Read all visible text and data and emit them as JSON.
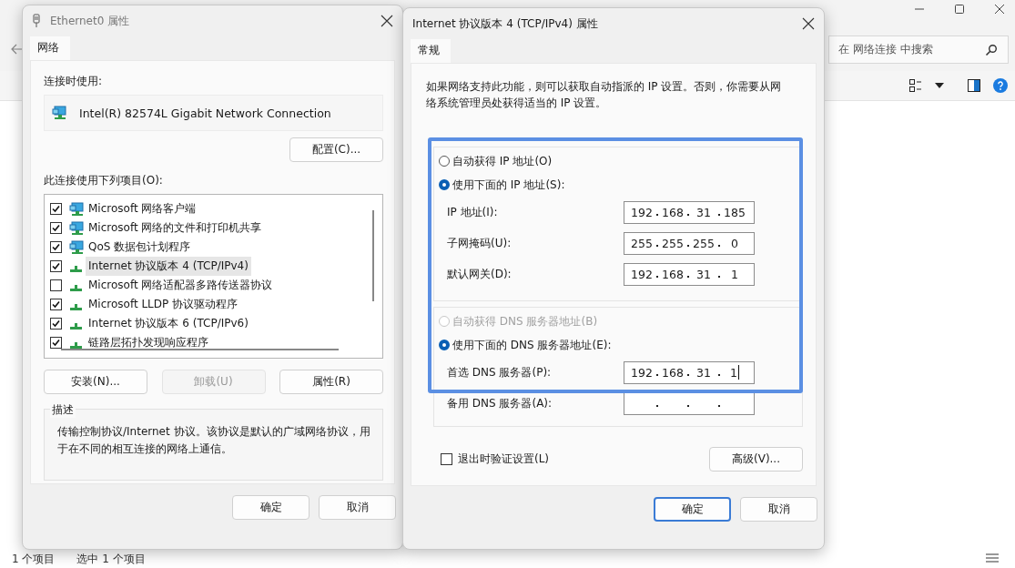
{
  "explorer": {
    "search": {
      "placeholder": "在 网络连接 中搜索"
    },
    "status_bar": [
      "1 个项目",
      "选中 1 个项目"
    ]
  },
  "adapter_dialog": {
    "title": "Ethernet0 属性",
    "tabs": [
      {
        "label": "网络",
        "selected": true
      }
    ],
    "connect_using_label": "连接时使用:",
    "adapter_name": "Intel(R) 82574L Gigabit Network Connection",
    "configure_button": "配置(C)...",
    "items_label": "此连接使用下列项目(O):",
    "items": [
      {
        "label": "Microsoft 网络客户端",
        "checked": true,
        "selected": false,
        "kind": "client"
      },
      {
        "label": "Microsoft 网络的文件和打印机共享",
        "checked": true,
        "selected": false,
        "kind": "client"
      },
      {
        "label": "QoS 数据包计划程序",
        "checked": true,
        "selected": false,
        "kind": "client"
      },
      {
        "label": "Internet 协议版本 4 (TCP/IPv4)",
        "checked": true,
        "selected": true,
        "kind": "protocol"
      },
      {
        "label": "Microsoft 网络适配器多路传送器协议",
        "checked": false,
        "selected": false,
        "kind": "protocol"
      },
      {
        "label": "Microsoft LLDP 协议驱动程序",
        "checked": true,
        "selected": false,
        "kind": "protocol"
      },
      {
        "label": "Internet 协议版本 6 (TCP/IPv6)",
        "checked": true,
        "selected": false,
        "kind": "protocol"
      },
      {
        "label": "链路层拓扑发现响应程序",
        "checked": true,
        "selected": false,
        "kind": "protocol"
      }
    ],
    "buttons": [
      {
        "label": "安装(N)...",
        "disabled": false
      },
      {
        "label": "卸载(U)",
        "disabled": true
      },
      {
        "label": "属性(R)",
        "disabled": false
      }
    ],
    "description_title": "描述",
    "description": "传输控制协议/Internet 协议。该协议是默认的广域网络协议，用于在不同的相互连接的网络上通信。",
    "footer_buttons": [
      {
        "label": "确定",
        "default": false
      },
      {
        "label": "取消",
        "default": false
      }
    ]
  },
  "ipv4_dialog": {
    "title": "Internet 协议版本 4 (TCP/IPv4) 属性",
    "tabs": [
      {
        "label": "常规",
        "selected": true
      }
    ],
    "intro": "如果网络支持此功能，则可以获取自动指派的 IP 设置。否则，你需要从网络系统管理员处获得适当的 IP 设置。",
    "ip_options": [
      {
        "label": "自动获得 IP 地址(O)",
        "selected": false,
        "disabled": false
      },
      {
        "label": "使用下面的 IP 地址(S):",
        "selected": true,
        "disabled": false
      }
    ],
    "ip_fields": [
      {
        "label": "IP 地址(I):",
        "octets": [
          "192",
          "168",
          "31",
          "185"
        ],
        "focused": false
      },
      {
        "label": "子网掩码(U):",
        "octets": [
          "255",
          "255",
          "255",
          "0"
        ],
        "focused": false
      },
      {
        "label": "默认网关(D):",
        "octets": [
          "192",
          "168",
          "31",
          "1"
        ],
        "focused": false
      }
    ],
    "dns_options": [
      {
        "label": "自动获得 DNS 服务器地址(B)",
        "selected": false,
        "disabled": true
      },
      {
        "label": "使用下面的 DNS 服务器地址(E):",
        "selected": true,
        "disabled": false
      }
    ],
    "dns_fields": [
      {
        "label": "首选 DNS 服务器(P):",
        "octets": [
          "192",
          "168",
          "31",
          "1"
        ],
        "focused": true
      },
      {
        "label": "备用 DNS 服务器(A):",
        "focused": false
      }
    ],
    "validate_checkbox": {
      "label": "退出时验证设置(L)",
      "checked": false
    },
    "advanced_button": "高级(V)...",
    "footer_buttons": [
      {
        "label": "确定",
        "default": true
      },
      {
        "label": "取消",
        "default": false
      }
    ]
  }
}
